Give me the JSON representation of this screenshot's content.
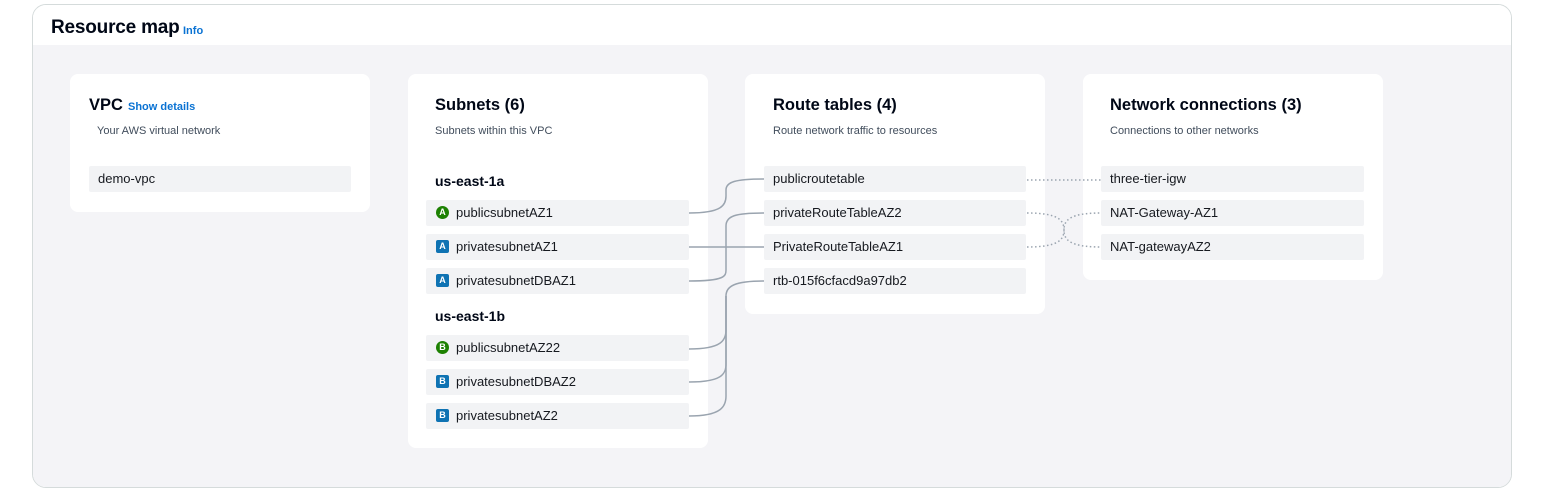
{
  "header": {
    "title": "Resource map",
    "info_label": "Info"
  },
  "vpc": {
    "title": "VPC",
    "show_details": "Show details",
    "subtitle": "Your AWS virtual network",
    "name": "demo-vpc"
  },
  "subnets": {
    "title": "Subnets (6)",
    "subtitle": "Subnets within this VPC",
    "groups": [
      {
        "az": "us-east-1a",
        "items": [
          {
            "badge": "A",
            "type": "public",
            "name": "publicsubnetAZ1"
          },
          {
            "badge": "A",
            "type": "private",
            "name": "privatesubnetAZ1"
          },
          {
            "badge": "A",
            "type": "private",
            "name": "privatesubnetDBAZ1"
          }
        ]
      },
      {
        "az": "us-east-1b",
        "items": [
          {
            "badge": "B",
            "type": "public",
            "name": "publicsubnetAZ22"
          },
          {
            "badge": "B",
            "type": "private",
            "name": "privatesubnetDBAZ2"
          },
          {
            "badge": "B",
            "type": "private",
            "name": "privatesubnetAZ2"
          }
        ]
      }
    ]
  },
  "route_tables": {
    "title": "Route tables (4)",
    "subtitle": "Route network traffic to resources",
    "items": [
      "publicroutetable",
      "privateRouteTableAZ2",
      "PrivateRouteTableAZ1",
      "rtb-015f6cfacd9a97db2"
    ]
  },
  "network_connections": {
    "title": "Network connections (3)",
    "subtitle": "Connections to other networks",
    "items": [
      "three-tier-igw",
      "NAT-Gateway-AZ1",
      "NAT-gatewayAZ2"
    ]
  },
  "colors": {
    "public_badge": "#1d8102",
    "private_badge": "#0f73b3",
    "link_blue": "#0972d3",
    "connector": "#8d99a8",
    "canvas_bg": "#f4f4f7"
  }
}
